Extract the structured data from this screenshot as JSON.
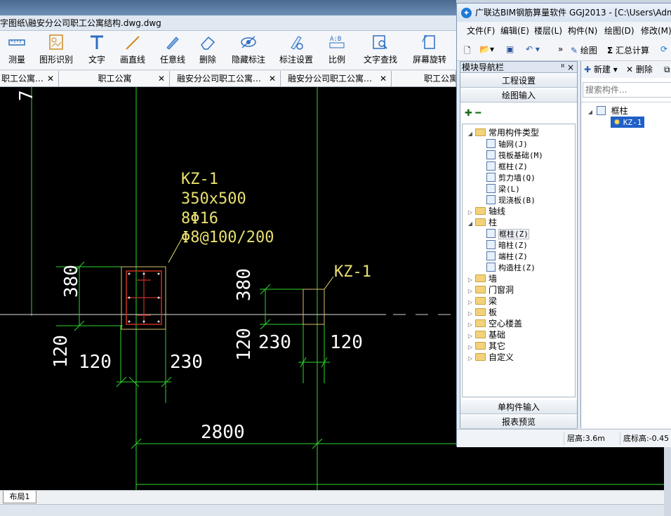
{
  "cad": {
    "title": "字图纸\\融安分公司职工公寓结构.dwg.dwg",
    "toolbar": [
      {
        "label": "测量",
        "icon": "measure-icon"
      },
      {
        "label": "图形识别",
        "icon": "shape-recognize-icon"
      },
      {
        "label": "文字",
        "icon": "text-icon"
      },
      {
        "label": "画直线",
        "icon": "line-icon"
      },
      {
        "label": "任意线",
        "icon": "freeline-icon"
      },
      {
        "label": "删除",
        "icon": "eraser-icon"
      },
      {
        "label": "隐藏标注",
        "icon": "eye-hide-icon"
      },
      {
        "label": "标注设置",
        "icon": "annotation-settings-icon"
      },
      {
        "label": "比例",
        "icon": "scale-icon"
      },
      {
        "label": "文字查找",
        "icon": "text-search-icon"
      },
      {
        "label": "屏幕旋转",
        "icon": "rotate-screen-icon"
      }
    ],
    "tabs": [
      {
        "label": "职工公寓…"
      },
      {
        "label": "职工公寓"
      },
      {
        "label": "融安分公司职工公寓…"
      },
      {
        "label": "融安分公司职工公寓…"
      },
      {
        "label": "职工公寓"
      }
    ],
    "drawing": {
      "col_label": "KZ-1",
      "col_size": "350x500",
      "col_rebar": "8Φ16",
      "col_stirrup": "Φ8@100/200",
      "col2_label": "KZ-1",
      "dims": {
        "d380a": "380",
        "d120a": "120",
        "d120b": "120",
        "d230a": "230",
        "d380b": "380",
        "d120c": "120",
        "d230b": "230",
        "d120d": "120",
        "d2800": "2800",
        "d7": "7"
      }
    },
    "layout_tab": "布局1"
  },
  "ggj": {
    "title": "广联达BIM钢筋算量软件 GGJ2013 - [C:\\Users\\Adm",
    "menu": [
      "文件(F)",
      "编辑(E)",
      "楼层(L)",
      "构件(N)",
      "绘图(D)",
      "修改(M)"
    ],
    "toolbar": {
      "draw": "绘图",
      "sum": "汇总计算",
      "more": "»"
    },
    "nav": {
      "title": "模块导航栏",
      "pin": "ᐦ",
      "close": "×",
      "btn_project": "工程设置",
      "btn_draw": "绘图输入",
      "btn_single": "单构件输入",
      "btn_report": "报表预览",
      "tree": [
        {
          "label": "常用构件类型",
          "level": 0,
          "type": "folder",
          "expanded": true
        },
        {
          "label": "轴网(J)",
          "level": 1,
          "type": "item"
        },
        {
          "label": "筏板基础(M)",
          "level": 1,
          "type": "item"
        },
        {
          "label": "框柱(Z)",
          "level": 1,
          "type": "item"
        },
        {
          "label": "剪力墙(Q)",
          "level": 1,
          "type": "item"
        },
        {
          "label": "梁(L)",
          "level": 1,
          "type": "item"
        },
        {
          "label": "现浇板(B)",
          "level": 1,
          "type": "item"
        },
        {
          "label": "轴线",
          "level": 0,
          "type": "folder",
          "expanded": false
        },
        {
          "label": "柱",
          "level": 0,
          "type": "folder",
          "expanded": true
        },
        {
          "label": "框柱(Z)",
          "level": 1,
          "type": "item",
          "selected": true
        },
        {
          "label": "暗柱(Z)",
          "level": 1,
          "type": "item"
        },
        {
          "label": "端柱(Z)",
          "level": 1,
          "type": "item"
        },
        {
          "label": "构造柱(Z)",
          "level": 1,
          "type": "item"
        },
        {
          "label": "墙",
          "level": 0,
          "type": "folder",
          "expanded": false
        },
        {
          "label": "门窗洞",
          "level": 0,
          "type": "folder",
          "expanded": false
        },
        {
          "label": "梁",
          "level": 0,
          "type": "folder",
          "expanded": false
        },
        {
          "label": "板",
          "level": 0,
          "type": "folder",
          "expanded": false
        },
        {
          "label": "空心楼盖",
          "level": 0,
          "type": "folder",
          "expanded": false
        },
        {
          "label": "基础",
          "level": 0,
          "type": "folder",
          "expanded": false
        },
        {
          "label": "其它",
          "level": 0,
          "type": "folder",
          "expanded": false
        },
        {
          "label": "自定义",
          "level": 0,
          "type": "folder",
          "expanded": false
        }
      ]
    },
    "components": {
      "new_label": "新建",
      "delete_label": "删除",
      "search_placeholder": "搜索构件...",
      "root": "框柱",
      "child": "KZ-1"
    },
    "status": {
      "floor_height": "层高:3.6m",
      "base_elev": "底标高:-0.45"
    }
  },
  "colors": {
    "cad_bg": "#000000",
    "line_green": "#2bd62b",
    "text_yellow": "#e8e070",
    "text_white": "#ffffff",
    "column_outline": "#d8c070",
    "rebar_red": "#c83020"
  }
}
